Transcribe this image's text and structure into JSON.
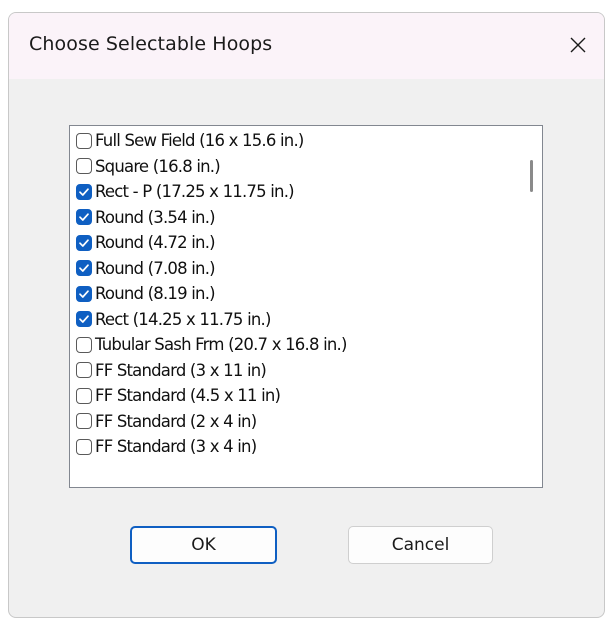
{
  "dialog": {
    "title": "Choose Selectable Hoops",
    "close_icon": "close-icon"
  },
  "hoops": [
    {
      "label": "Full Sew Field (16 x 15.6 in.)",
      "checked": false
    },
    {
      "label": "Square (16.8 in.)",
      "checked": false
    },
    {
      "label": "Rect - P (17.25 x 11.75 in.)",
      "checked": true
    },
    {
      "label": "Round (3.54 in.)",
      "checked": true
    },
    {
      "label": "Round (4.72 in.)",
      "checked": true
    },
    {
      "label": "Round (7.08 in.)",
      "checked": true
    },
    {
      "label": "Round (8.19 in.)",
      "checked": true
    },
    {
      "label": "Rect (14.25 x 11.75 in.)",
      "checked": true
    },
    {
      "label": "Tubular Sash Frm (20.7 x 16.8 in.)",
      "checked": false
    },
    {
      "label": "FF Standard (3 x 11 in)",
      "checked": false
    },
    {
      "label": "FF Standard (4.5 x 11 in)",
      "checked": false
    },
    {
      "label": "FF Standard (2 x 4 in)",
      "checked": false
    },
    {
      "label": "FF Standard (3 x 4 in)",
      "checked": false
    }
  ],
  "buttons": {
    "ok_label": "OK",
    "cancel_label": "Cancel"
  },
  "colors": {
    "accent": "#0f5fc2",
    "dialog_bg": "#f0f0f0",
    "titlebar_bg": "#fbf3f9"
  }
}
